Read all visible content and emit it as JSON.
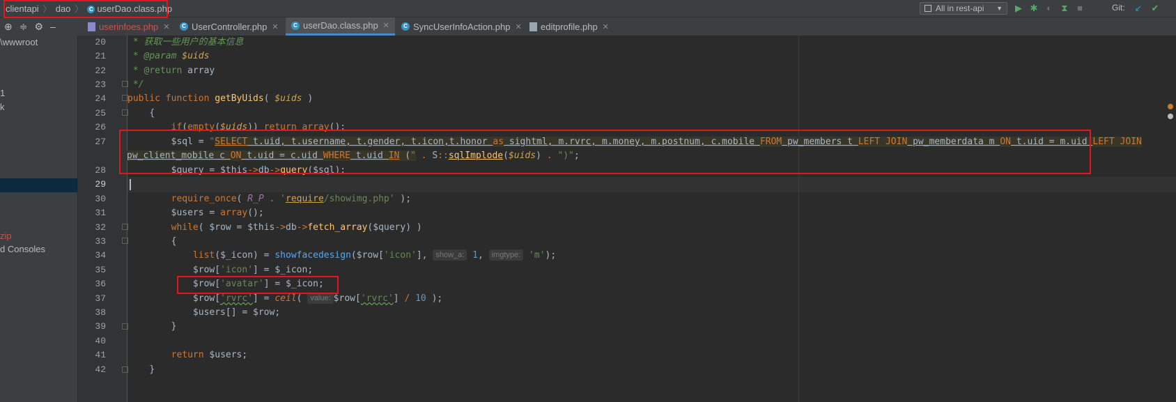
{
  "breadcrumbs": [
    "clientapi",
    "dao",
    "userDao.class.php"
  ],
  "breadcrumb_icon_letter": "C",
  "run_config": {
    "label": "All in rest-api"
  },
  "toolbar": {
    "git_label": "Git:"
  },
  "tabs": [
    {
      "label": "userinfoes.php",
      "modified": true
    },
    {
      "label": "UserController.php",
      "icon_letter": "C"
    },
    {
      "label": "userDao.class.php",
      "icon_letter": "C",
      "active": true
    },
    {
      "label": "SyncUserInfoAction.php",
      "icon_letter": "C"
    },
    {
      "label": "editprofile.php"
    }
  ],
  "project_panel": {
    "path": "\\wwwroot",
    "item_a": "1",
    "item_b": "k",
    "item_zip": "zip",
    "item_consoles": "d Consoles"
  },
  "code": {
    "line_numbers": [
      "20",
      "21",
      "22",
      "23",
      "24",
      "25",
      "26",
      "27",
      "28",
      "29",
      "30",
      "31",
      "32",
      "33",
      "34",
      "35",
      "36",
      "37",
      "38",
      "39",
      "40",
      "41",
      "42"
    ],
    "l20_comment": " * 获取一些用户的基本信息",
    "l21_star": " * ",
    "l21_tag": "@param",
    "l21_var": "$uids",
    "l22_star": " * ",
    "l22_tag": "@return",
    "l22_type": " array",
    "l23": " */",
    "l24_kw1": "public",
    "l24_kw2": "function",
    "l24_name": "getByUids",
    "l24_paren_open": "( ",
    "l24_param": "$uids",
    "l24_paren_close": " )",
    "l25": "{",
    "l26_kw": "if",
    "l26_fn": "empty",
    "l26_var": "$uids",
    "l26_ret": "return",
    "l26_arr": "array",
    "l27_var": "$sql",
    "l27_eq": " = ",
    "l27_q": "\"",
    "l27_select": "SELECT",
    "l27_cols": " t.uid, t.username, t.gender, t.icon,t.honor ",
    "l27_as": "as",
    "l27_cols2": " sightml, m.rvrc, m.money, m.postnum, c.mobile ",
    "l27_from": "FROM",
    "l27_t1": " pw_members t ",
    "l27_lj1": "LEFT JOIN",
    "l27_t2": " pw_memberdata m ",
    "l27_on1": "ON",
    "l27_c1": " t.uid = m.uid ",
    "l27_lj2": "LEFT JOIN",
    "l27b_t3": "pw_client_mobile c ",
    "l27b_on2": "ON",
    "l27b_c2": " t.uid = c.uid ",
    "l27b_where": "WHERE",
    "l27b_c3": " t.uid ",
    "l27b_in": "IN",
    "l27b_open": " (",
    "l27b_q1": "\"",
    "l27b_dot1": " . ",
    "l27b_cls": "S",
    "l27b_scope": "::",
    "l27b_fn": "sqlImplode",
    "l27b_var": "$uids",
    "l27b_dot2": " . ",
    "l27b_q2": "\")\"",
    "l27b_end": ";",
    "l28_var": "$query",
    "l28_this": "$this",
    "l28_db": "db",
    "l28_fn": "query",
    "l28_arg": "$sql",
    "l30_fn": "require_once",
    "l30_const": "R_P",
    "l30_str_a": "'",
    "l30_str_b": "require",
    "l30_str_c": "/showimg.php'",
    "l31_var": "$users",
    "l31_arr": "array",
    "l32_kw": "while",
    "l32_row": "$row",
    "l32_this": "$this",
    "l32_db": "db",
    "l32_fn": "fetch_array",
    "l32_arg": "$query",
    "l33": "{",
    "l34_fn": "list",
    "l34_icon": "$_icon",
    "l34_fn2": "showfacedesign",
    "l34_row": "$row",
    "l34_key": "'icon'",
    "l34_hint1": "show_a:",
    "l34_num": "1",
    "l34_hint2": "imgtype:",
    "l34_str": "'m'",
    "l35_row": "$row",
    "l35_key": "'icon'",
    "l35_icon": "$_icon",
    "l36_row": "$row",
    "l36_key": "'avatar'",
    "l36_icon": "$_icon",
    "l37_row": "$row",
    "l37_key": "'rvrc'",
    "l37_fn": "ceil",
    "l37_hint": "value:",
    "l37_row2": "$row",
    "l37_key2": "'rvrc'",
    "l37_num": "10",
    "l38_var": "$users",
    "l38_row": "$row",
    "l39": "}",
    "l41_kw": "return",
    "l41_var": "$users",
    "l42": "}"
  },
  "colors": {
    "annotation_red": "#e8141b",
    "accent_blue": "#4a88c7",
    "run_green": "#59a869",
    "git_blue": "#3592c4"
  }
}
